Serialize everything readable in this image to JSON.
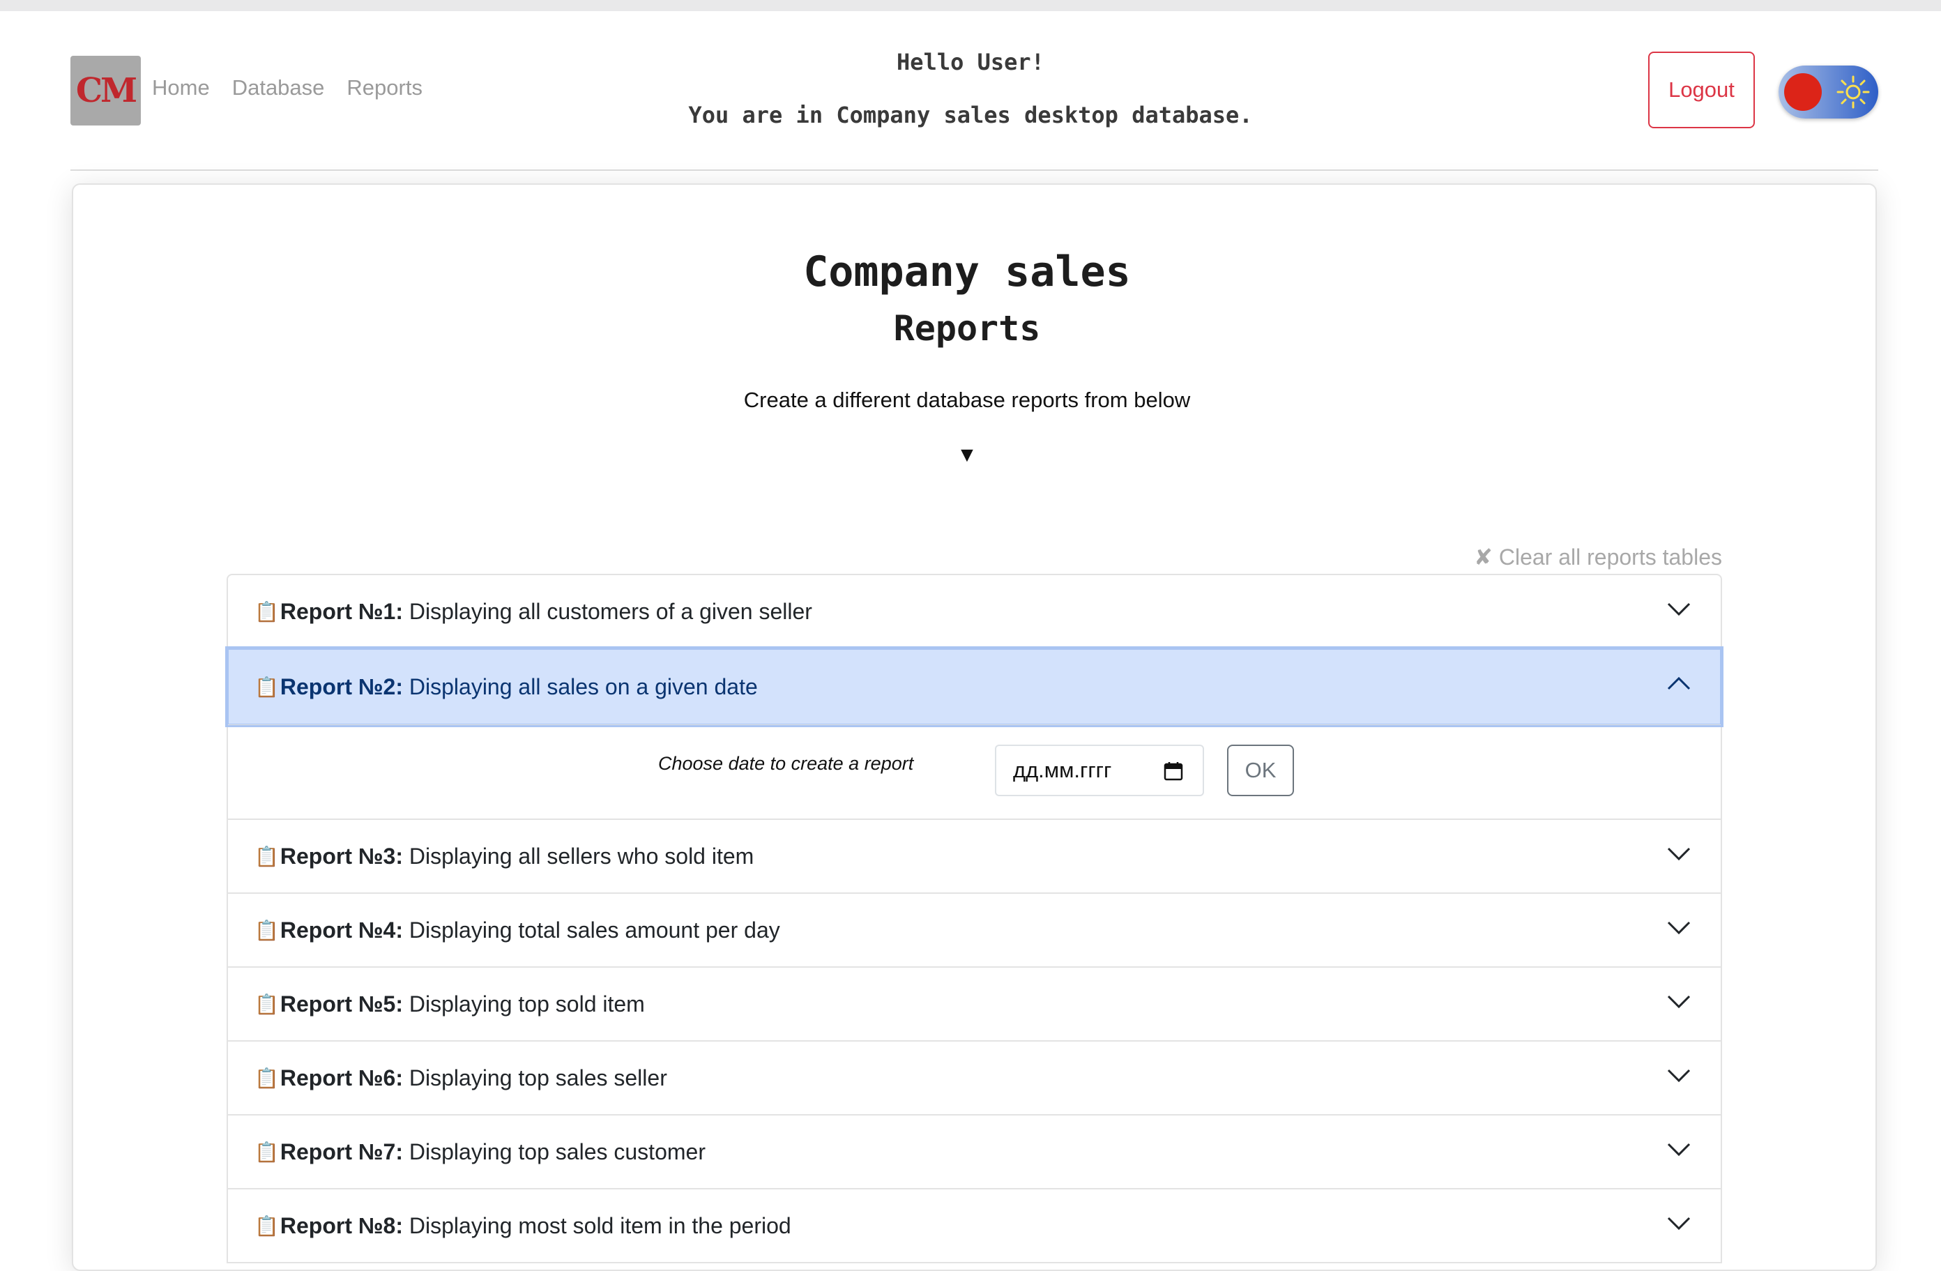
{
  "header": {
    "logo_text": "CM",
    "nav": [
      "Home",
      "Database",
      "Reports"
    ],
    "greeting": "Hello User!",
    "location_text": "You are in Company sales desktop database.",
    "logout_label": "Logout"
  },
  "theme_toggle": {
    "state": "light"
  },
  "page": {
    "title": "Company sales",
    "subtitle": "Reports",
    "description": "Create a different database reports from below",
    "arrow": "▼",
    "clear_all": "✘ Clear all reports tables"
  },
  "reports": [
    {
      "label": "Report №1:",
      "text": "Displaying all customers of a given seller",
      "expanded": false
    },
    {
      "label": "Report №2:",
      "text": "Displaying all sales on a given date",
      "expanded": true
    },
    {
      "label": "Report №3:",
      "text": "Displaying all sellers who sold item",
      "expanded": false
    },
    {
      "label": "Report №4:",
      "text": "Displaying total sales amount per day",
      "expanded": false
    },
    {
      "label": "Report №5:",
      "text": "Displaying top sold item",
      "expanded": false
    },
    {
      "label": "Report №6:",
      "text": "Displaying top sales seller",
      "expanded": false
    },
    {
      "label": "Report №7:",
      "text": "Displaying top sales customer",
      "expanded": false
    },
    {
      "label": "Report №8:",
      "text": "Displaying most sold item in the period",
      "expanded": false
    }
  ],
  "report2_form": {
    "prompt": "Choose date to create a report",
    "date_placeholder": "дд.мм.гггг",
    "ok_label": "OK"
  },
  "icons": {
    "report": "📋"
  },
  "colors": {
    "accent_danger": "#dc3545",
    "active_header_bg": "#d3e2fc"
  }
}
